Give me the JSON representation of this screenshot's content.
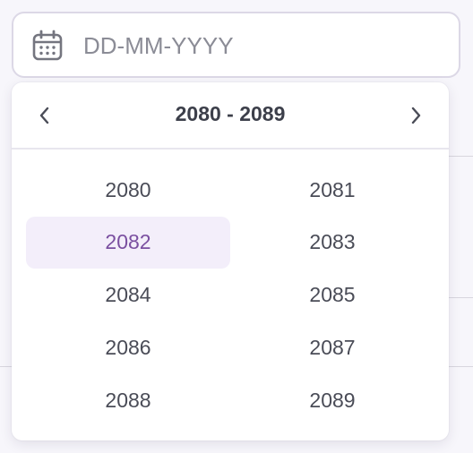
{
  "date_input": {
    "value": "",
    "placeholder": "DD-MM-YYYY"
  },
  "picker": {
    "range_title": "2080 - 2089",
    "years": [
      {
        "label": "2080",
        "selected": false
      },
      {
        "label": "2081",
        "selected": false
      },
      {
        "label": "2082",
        "selected": true
      },
      {
        "label": "2083",
        "selected": false
      },
      {
        "label": "2084",
        "selected": false
      },
      {
        "label": "2085",
        "selected": false
      },
      {
        "label": "2086",
        "selected": false
      },
      {
        "label": "2087",
        "selected": false
      },
      {
        "label": "2088",
        "selected": false
      },
      {
        "label": "2089",
        "selected": false
      }
    ]
  },
  "colors": {
    "accent": "#7a4fa0",
    "selected_bg": "#f3eefa",
    "text": "#4a4c57",
    "placeholder": "#8b8c96"
  },
  "icons": {
    "input_icon": "calendar-icon",
    "prev": "chevron-left-icon",
    "next": "chevron-right-icon"
  }
}
